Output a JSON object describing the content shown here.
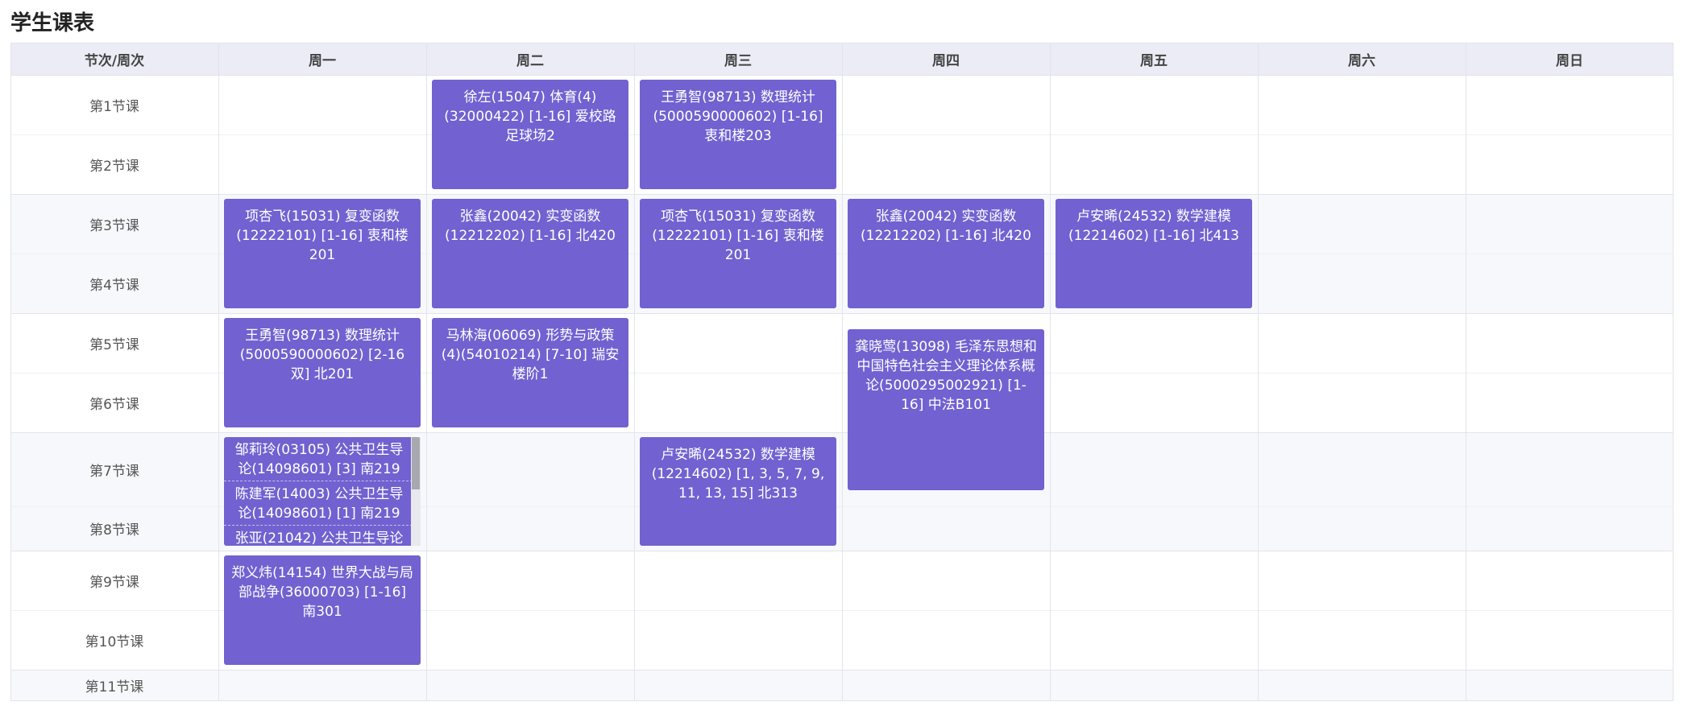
{
  "title": "学生课表",
  "colors": {
    "header_bg": "#ebecf5",
    "card": "#7261d0",
    "grid_line": "#e3e4ea",
    "stripe": "#f7f8fb"
  },
  "headers": [
    "节次/周次",
    "周一",
    "周二",
    "周三",
    "周四",
    "周五",
    "周六",
    "周日"
  ],
  "periods": [
    "第1节课",
    "第2节课",
    "第3节课",
    "第4节课",
    "第5节课",
    "第6节课",
    "第7节课",
    "第8节课",
    "第9节课",
    "第10节课",
    "第11节课"
  ],
  "courses": [
    {
      "day": 2,
      "start": 1,
      "end": 2,
      "text": "徐左(15047) 体育(4)(32000422) [1-16] 爱校路足球场2"
    },
    {
      "day": 3,
      "start": 1,
      "end": 2,
      "text": "王勇智(98713) 数理统计(5000590000602) [1-16] 衷和楼203"
    },
    {
      "day": 1,
      "start": 3,
      "end": 4,
      "text": "项杏飞(15031) 复变函数(12222101) [1-16] 衷和楼201"
    },
    {
      "day": 2,
      "start": 3,
      "end": 4,
      "text": "张鑫(20042) 实变函数(12212202) [1-16] 北420"
    },
    {
      "day": 3,
      "start": 3,
      "end": 4,
      "text": "项杏飞(15031) 复变函数(12222101) [1-16] 衷和楼201"
    },
    {
      "day": 4,
      "start": 3,
      "end": 4,
      "text": "张鑫(20042) 实变函数(12212202) [1-16] 北420"
    },
    {
      "day": 5,
      "start": 3,
      "end": 4,
      "text": "卢安晞(24532) 数学建模(12214602) [1-16] 北413"
    },
    {
      "day": 1,
      "start": 5,
      "end": 6,
      "text": "王勇智(98713) 数理统计(5000590000602) [2-16双] 北201"
    },
    {
      "day": 2,
      "start": 5,
      "end": 6,
      "text": "马林海(06069) 形势与政策(4)(54010214) [7-10] 瑞安楼阶1"
    },
    {
      "day": 4,
      "start": 5,
      "end": 7,
      "text": "龚晓莺(13098) 毛泽东思想和中国特色社会主义理论体系概论(5000295002921) [1-16] 中法B101"
    },
    {
      "day": 3,
      "start": 7,
      "end": 8,
      "text": "卢安晞(24532) 数学建模(12214602) [1, 3, 5, 7, 9, 11, 13, 15] 北313"
    },
    {
      "day": 1,
      "start": 9,
      "end": 10,
      "text": "郑义炜(14154) 世界大战与局部战争(36000703) [1-16] 南301"
    }
  ],
  "stacked": {
    "day": 1,
    "start": 7,
    "end": 8,
    "items": [
      "邹莉玲(03105) 公共卫生导论(14098601) [3] 南219",
      "陈建军(14003) 公共卫生导论(14098601) [1] 南219",
      "张亚(21042) 公共卫生导论"
    ]
  }
}
